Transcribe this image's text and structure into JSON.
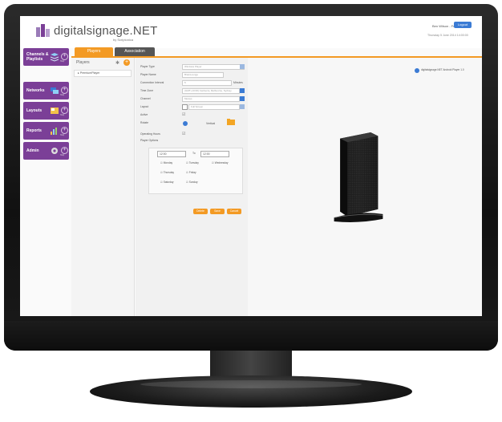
{
  "app": {
    "logo_text": "digitalsignage.NET",
    "logo_sub": "by Scriptonica",
    "user_name": "Ben Wilson - Free",
    "logout_label": "Logout",
    "date": "Thursday 5 June 2014 14:00:00"
  },
  "sidebar": {
    "items": [
      {
        "label": "Channels & Playlists",
        "sub": "Help"
      },
      {
        "label": "Networks",
        "sub": "Help"
      },
      {
        "label": "Layouts",
        "sub": "Help"
      },
      {
        "label": "Reports",
        "sub": "Help"
      },
      {
        "label": "Admin",
        "sub": "Help"
      }
    ]
  },
  "tabs": [
    {
      "label": "Players"
    },
    {
      "label": "Association"
    }
  ],
  "players_panel": {
    "title": "Players",
    "items": [
      "PremiumPlayer"
    ]
  },
  "form": {
    "fields": [
      {
        "label": "Player Type",
        "value": "Windows Player"
      },
      {
        "label": "Player Name",
        "value": "BrainLounge"
      },
      {
        "label": "Connection Interval",
        "value": "5",
        "unit": "Minutes"
      },
      {
        "label": "Time Zone",
        "value": "(GMT+10:00) Canberra, Melbourne, Sydney"
      },
      {
        "label": "Channel",
        "value": "Movies"
      },
      {
        "label": "Layout",
        "value": "Full Screen"
      },
      {
        "label": "Active",
        "value": ""
      },
      {
        "label": "Rotate",
        "value": "Vertical"
      },
      {
        "label": "Operating Hours",
        "value": ""
      },
      {
        "label": "Player Options",
        "value": ""
      }
    ],
    "schedule": {
      "from": "12:00",
      "to": "12:00",
      "to_label": "To",
      "days": [
        "Monday",
        "Tuesday",
        "Wednesday",
        "Thursday",
        "Friday",
        "Saturday",
        "Sunday"
      ]
    },
    "buttons": [
      "Delete",
      "Save",
      "Cancel"
    ]
  },
  "detail": {
    "info": "digitalsignage.NET Android Player 1.0"
  },
  "colors": {
    "accent": "#f39a24",
    "nav": "#7b3f97",
    "blue": "#3b7bd4"
  }
}
